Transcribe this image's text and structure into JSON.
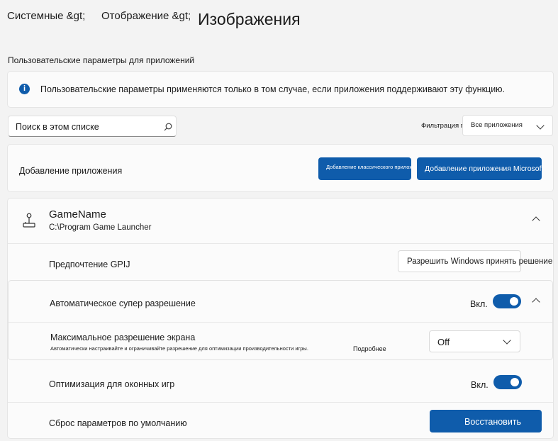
{
  "breadcrumb": {
    "item1": "Системные &gt;",
    "item2": "Отображение &gt;",
    "current": "Изображения"
  },
  "section_title": "Пользовательские параметры для приложений",
  "info": {
    "icon": "info-icon",
    "text": "Пользовательские параметры применяются только в том случае, если приложения поддерживают эту функцию."
  },
  "search": {
    "placeholder": "Поиск в этом списке",
    "icon": "search-icon"
  },
  "filter": {
    "label": "Фильтрация по:",
    "value": "Все приложения"
  },
  "add_app": {
    "label": "Добавление приложения",
    "classic_button": "Добавление классического приложения",
    "store_button": "Добавление приложения Microsoft Store"
  },
  "app": {
    "name": "GameName",
    "path": "C:\\Program Game Launcher",
    "icon": "joystick-icon",
    "gpu_label": "Предпочтение GPIJ",
    "gpu_button": "Разрешить Windows принять решение",
    "auto_sr_label": "Автоматическое супер разрешение",
    "auto_sr_state": "Вкл.",
    "max_res_label": "Максимальное разрешение экрана",
    "max_res_desc": "Автоматически настраивайте и ограничивайте разрешение для оптимизации производительности игры.",
    "more_link": "Подробнее",
    "max_res_value": "Off",
    "windowed_label": "Оптимизация для оконных игр",
    "windowed_state": "Вкл.",
    "reset_label": "Сброс параметров по умолчанию",
    "reset_button": "Восстановить"
  },
  "colors": {
    "accent": "#0f5cab",
    "background": "#f3f3f3",
    "card": "#fbfbfb"
  }
}
